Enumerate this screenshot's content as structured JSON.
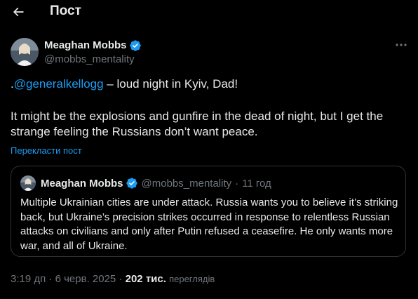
{
  "header": {
    "title": "Пост"
  },
  "tweet": {
    "author_name": "Meaghan Mobbs",
    "author_handle": "@mobbs_mentality",
    "prefix": ".",
    "mention": "@generalkellogg",
    "line1_rest": " – loud night in Kyiv, Dad!",
    "paragraph2": "It might be the explosions and gunfire in the dead of night, but I get the strange feeling the Russians don’t want peace.",
    "translate_label": "Перекласти пост",
    "time": "3:19 дп",
    "date": "6 черв. 2025",
    "views_count": "202 тис.",
    "views_label": "переглядів"
  },
  "quote": {
    "author_name": "Meaghan Mobbs",
    "author_handle": "@mobbs_mentality",
    "time_ago": "11 год",
    "text": "Multiple Ukrainian cities are under attack. Russia wants you to believe it’s striking back, but Ukraine’s precision strikes occurred in response to relentless Russian attacks on civilians and only after Putin refused a ceasefire. He only wants more war, and all of Ukraine."
  },
  "colors": {
    "background": "#000000",
    "text": "#e7e9ea",
    "secondary": "#71767b",
    "accent": "#1d9bf0",
    "border": "#2f3336"
  },
  "icons": [
    "back-arrow-icon",
    "verified-badge-icon",
    "more-dots-icon"
  ]
}
